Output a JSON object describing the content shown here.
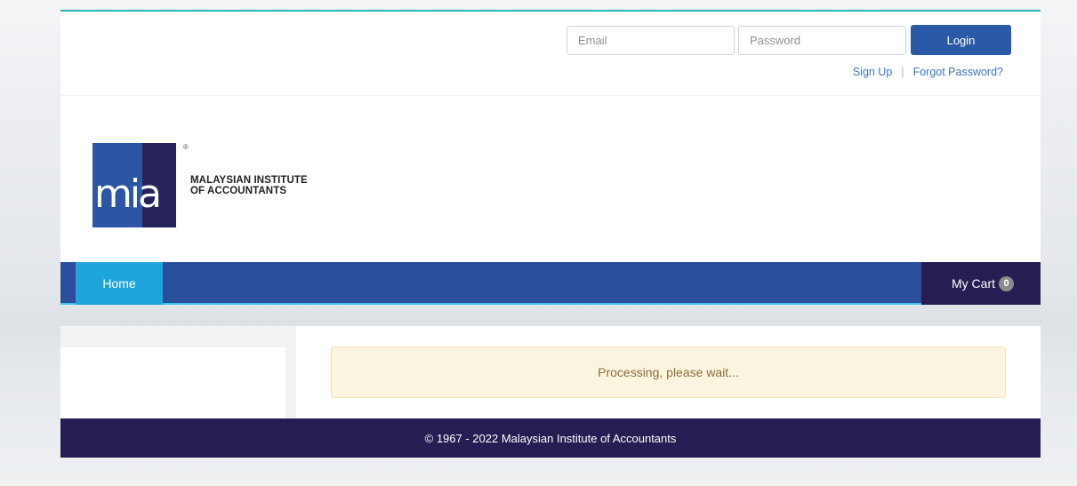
{
  "login": {
    "email_placeholder": "Email",
    "password_placeholder": "Password",
    "login_label": "Login",
    "signup_label": "Sign Up",
    "separator": "|",
    "forgot_label": "Forgot Password?"
  },
  "logo": {
    "mark_text": "mia",
    "registered": "®",
    "name_line1": "MALAYSIAN INSTITUTE",
    "name_line2": "OF ACCOUNTANTS"
  },
  "nav": {
    "home_label": "Home",
    "cart_label": "My Cart",
    "cart_count": "0"
  },
  "main": {
    "alert_text": "Processing, please wait..."
  },
  "footer": {
    "copyright": "© 1967 - 2022 Malaysian Institute of Accountants"
  },
  "colors": {
    "accent_teal": "#2ab7b2",
    "nav_blue": "#2b4e9c",
    "home_cyan": "#1ea5dc",
    "dark_purple": "#271d52"
  }
}
